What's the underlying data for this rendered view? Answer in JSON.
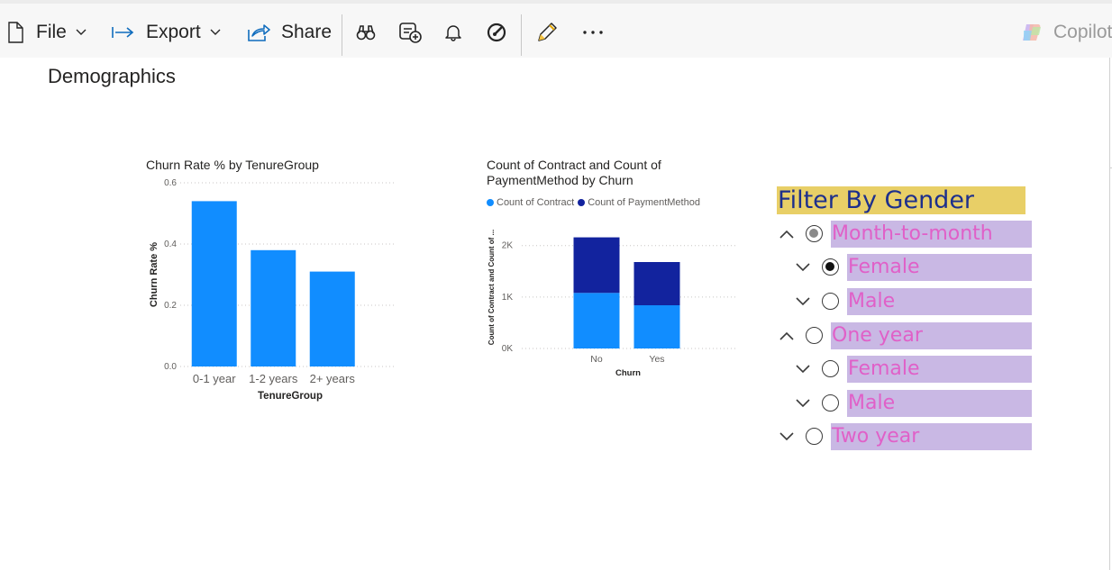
{
  "toolbar": {
    "file_label": "File",
    "export_label": "Export",
    "share_label": "Share",
    "copilot_label": "Copilot"
  },
  "page": {
    "title": "Demographics"
  },
  "chart_data": [
    {
      "type": "bar",
      "title": "Churn Rate % by TenureGroup",
      "xlabel": "TenureGroup",
      "ylabel": "Churn Rate %",
      "categories": [
        "0-1 year",
        "1-2 years",
        "2+ years"
      ],
      "values": [
        0.54,
        0.38,
        0.31
      ],
      "yticks": [
        "0.0",
        "0.2",
        "0.4",
        "0.6"
      ],
      "ylim": [
        0,
        0.6
      ],
      "grid": true,
      "color": "#118DFF"
    },
    {
      "type": "bar",
      "stacked": true,
      "title": "Count of Contract and Count of PaymentMethod by Churn",
      "title_lines": [
        "Count of Contract and Count of",
        "PaymentMethod by Churn"
      ],
      "xlabel": "Churn",
      "ylabel": "Count of Contract and Count of ...",
      "categories": [
        "No",
        "Yes"
      ],
      "series": [
        {
          "name": "Count of Contract",
          "color": "#118DFF",
          "values": [
            1080,
            840
          ]
        },
        {
          "name": "Count of PaymentMethod",
          "color": "#12239E",
          "values": [
            1080,
            840
          ]
        }
      ],
      "yticks": [
        "0K",
        "1K",
        "2K"
      ],
      "ylim": [
        0,
        2000
      ],
      "legend": "top-left",
      "grid": true
    }
  ],
  "slicer": {
    "title": "Filter By Gender",
    "items": [
      {
        "label": "Month-to-month",
        "expanded": true,
        "state": "partial",
        "level": 0
      },
      {
        "label": "Female",
        "expanded": false,
        "state": "selected",
        "level": 1
      },
      {
        "label": "Male",
        "expanded": false,
        "state": "none",
        "level": 1
      },
      {
        "label": "One year",
        "expanded": true,
        "state": "none",
        "level": 0
      },
      {
        "label": "Female",
        "expanded": false,
        "state": "none",
        "level": 1
      },
      {
        "label": "Male",
        "expanded": false,
        "state": "none",
        "level": 1
      },
      {
        "label": "Two year",
        "expanded": false,
        "state": "none",
        "level": 0
      }
    ]
  }
}
